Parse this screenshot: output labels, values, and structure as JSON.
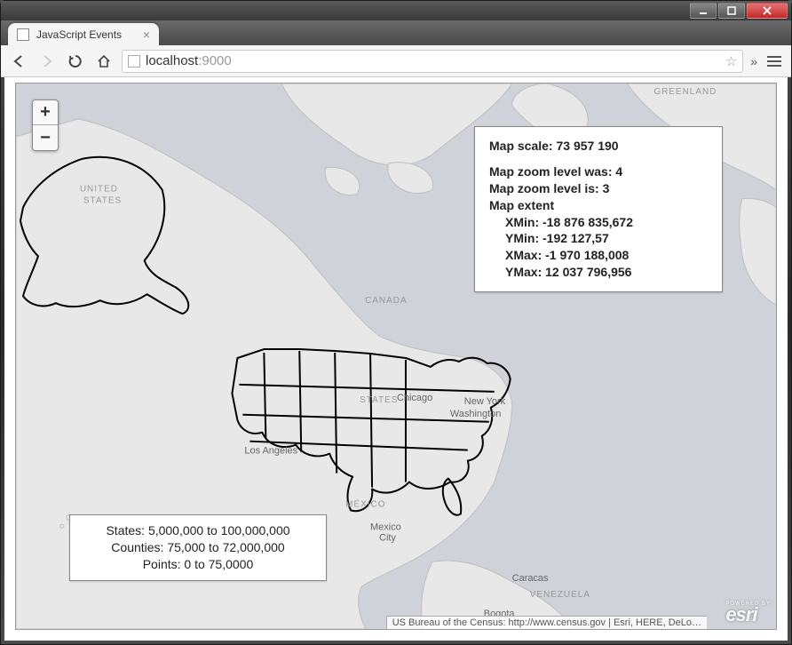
{
  "window": {
    "tab_title": "JavaScript Events",
    "url_host": "localhost",
    "url_port": ":9000"
  },
  "zoom": {
    "in": "+",
    "out": "−"
  },
  "info": {
    "scale_label": "Map scale:",
    "scale_value": "73 957 190",
    "zoom_was_label": "Map zoom level was:",
    "zoom_was_value": "4",
    "zoom_is_label": "Map zoom level is:",
    "zoom_is_value": "3",
    "extent_label": "Map extent",
    "xmin_label": "XMin:",
    "xmin_value": "-18 876 835,672",
    "ymin_label": "YMin:",
    "ymin_value": "-192 127,57",
    "xmax_label": "XMax:",
    "xmax_value": "-1 970 188,008",
    "ymax_label": "YMax:",
    "ymax_value": "12 037 796,956"
  },
  "legend": {
    "states": "States: 5,000,000 to 100,000,000",
    "counties": "Counties: 75,000 to 72,000,000",
    "points": "Points: 0 to 75,0000"
  },
  "map_labels": {
    "greenland": "GREENLAND",
    "united": "UNITED",
    "states": "STATES",
    "canada": "CANADA",
    "mexico": "MÉXICO",
    "venezuela": "VENEZUELA",
    "states2": "STATES"
  },
  "cities": {
    "los_angeles": "Los Angeles",
    "chicago": "Chicago",
    "new_york": "New York",
    "washington": "Washington",
    "mexico_city": "Mexico City",
    "bogota": "Bogota",
    "caracas": "Caracas"
  },
  "attribution": "US Bureau of the Census: http://www.census.gov | Esri, HERE, DeLo…",
  "esri": {
    "powered": "POWERED BY",
    "logo": "esri"
  }
}
